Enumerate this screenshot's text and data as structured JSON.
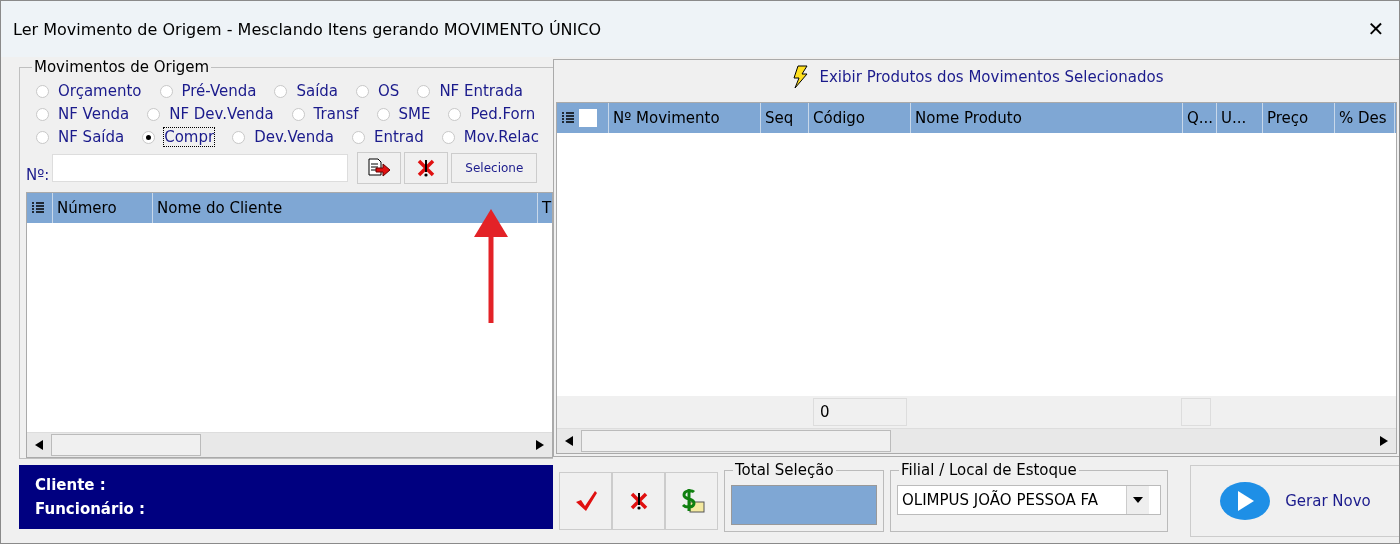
{
  "window": {
    "title": "Ler Movimento de Origem - Mesclando Itens gerando MOVIMENTO ÚNICO",
    "close": "✕"
  },
  "origin_group": {
    "title": "Movimentos de Origem",
    "radio_rows": [
      [
        {
          "label": "Orçamento",
          "selected": false
        },
        {
          "label": "Pré-Venda",
          "selected": false
        },
        {
          "label": "Saída",
          "selected": false
        },
        {
          "label": "OS",
          "selected": false
        },
        {
          "label": "NF Entrada",
          "selected": false
        }
      ],
      [
        {
          "label": "NF Venda",
          "selected": false
        },
        {
          "label": "NF Dev.Venda",
          "selected": false
        },
        {
          "label": "Transf",
          "selected": false
        },
        {
          "label": "SME",
          "selected": false
        },
        {
          "label": "Ped.Forn",
          "selected": false
        }
      ],
      [
        {
          "label": "NF Saída",
          "selected": false
        },
        {
          "label": "Compr",
          "selected": true
        },
        {
          "label": "Dev.Venda",
          "selected": false
        },
        {
          "label": "Entrad",
          "selected": false
        },
        {
          "label": "Mov.Relac",
          "selected": false
        }
      ]
    ],
    "number_label": "Nº:",
    "select_button": "Selecione",
    "table": {
      "columns": [
        "Número",
        "Nome do Cliente",
        "T"
      ]
    }
  },
  "info_panel": {
    "client_label": "Cliente :",
    "employee_label": "Funcionário :"
  },
  "products": {
    "show_button": "Exibir Produtos dos Movimentos Selecionados",
    "select_all_checked": false,
    "columns": [
      "Nº Movimento",
      "Seq",
      "Código",
      "Nome Produto",
      "Q...",
      "U...",
      "Preço",
      "% Des"
    ],
    "footer_count": "0"
  },
  "bottom": {
    "total_label": "Total Seleção",
    "branch_label": "Filial / Local de Estoque",
    "branch_value": "OLIMPUS JOÃO PESSOA FA",
    "generate_button": "Gerar Novo"
  }
}
